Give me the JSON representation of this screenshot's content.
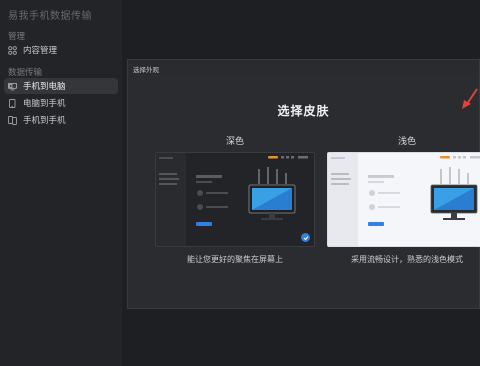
{
  "app": {
    "title": "易我手机数据传输"
  },
  "sidebar": {
    "section_manage": "管理",
    "content_manage": "内容管理",
    "section_transfer": "数据传输",
    "items": [
      {
        "label": "手机到电脑",
        "icon": "phone-to-pc-icon",
        "active": true
      },
      {
        "label": "电脑到手机",
        "icon": "pc-to-phone-icon",
        "active": false
      },
      {
        "label": "手机到手机",
        "icon": "phone-to-phone-icon",
        "active": false
      }
    ]
  },
  "modal": {
    "header": "选择外观",
    "title": "选择皮肤",
    "options": [
      {
        "label": "深色",
        "description": "能让您更好的聚焦在屏幕上",
        "selected": true
      },
      {
        "label": "浅色",
        "description": "采用流畅设计，熟悉的浅色模式",
        "selected": false
      }
    ]
  },
  "colors": {
    "accent": "#2f7fe6",
    "arrow": "#e0413a"
  }
}
